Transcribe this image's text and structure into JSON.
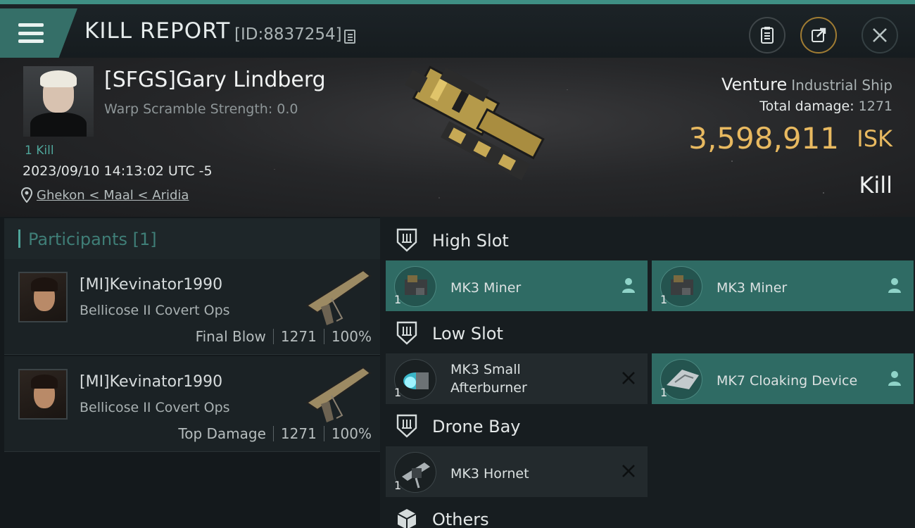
{
  "topbar": {
    "title": "KILL REPORT",
    "report_id": "[ID:8837254]"
  },
  "victim": {
    "name": "[SFGS]Gary Lindberg",
    "warp_scramble": "Warp Scramble Strength: 0.0",
    "kills": "1 Kill",
    "datetime": "2023/09/10 14:13:02 UTC -5",
    "location": "Ghekon < Maal < Aridia"
  },
  "ship": {
    "name": "Venture",
    "class": "Industrial Ship",
    "total_damage_label": "Total damage:",
    "total_damage_value": "1271",
    "isk_value": "3,598,911",
    "isk_label": "ISK",
    "result": "Kill"
  },
  "participants": {
    "title": "Participants [1]",
    "rows": [
      {
        "name": "[MI]Kevinator1990",
        "ship": "Bellicose II Covert Ops",
        "role": "Final Blow",
        "damage": "1271",
        "percent": "100%"
      },
      {
        "name": "[MI]Kevinator1990",
        "ship": "Bellicose II Covert Ops",
        "role": "Top Damage",
        "damage": "1271",
        "percent": "100%"
      }
    ]
  },
  "fitting": {
    "high_slot": {
      "label": "High Slot",
      "modules": [
        {
          "name": "MK3 Miner",
          "qty": "1",
          "status": "fitted"
        },
        {
          "name": "MK3 Miner",
          "qty": "1",
          "status": "fitted"
        }
      ]
    },
    "low_slot": {
      "label": "Low Slot",
      "modules": [
        {
          "name_line1": "MK3 Small",
          "name_line2": "Afterburner",
          "qty": "1",
          "status": "destroyed"
        },
        {
          "name": "MK7 Cloaking Device",
          "qty": "1",
          "status": "fitted"
        }
      ]
    },
    "drone_bay": {
      "label": "Drone Bay",
      "modules": [
        {
          "name": "MK3  Hornet",
          "qty": "1",
          "status": "destroyed"
        }
      ]
    },
    "others": {
      "label": "Others"
    }
  },
  "colors": {
    "accent": "#4fa69b",
    "fitted": "#2f6b64",
    "isk": "#e8b960"
  }
}
